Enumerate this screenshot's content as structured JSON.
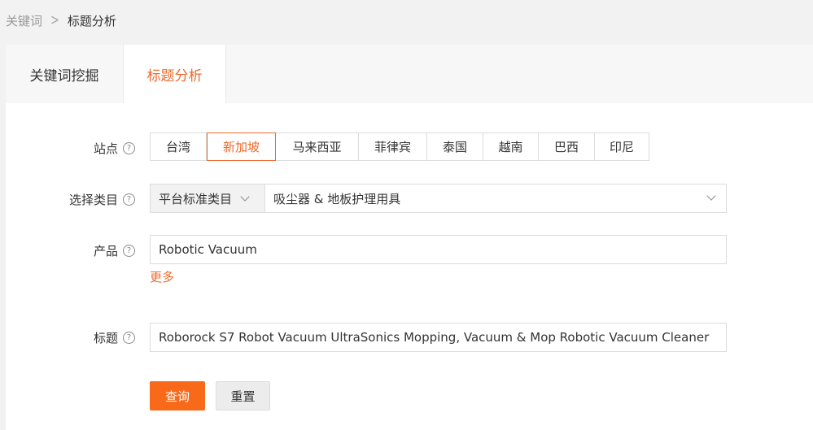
{
  "breadcrumb": {
    "prev": "关键词",
    "current": "标题分析"
  },
  "tabs": [
    {
      "label": "关键词挖掘"
    },
    {
      "label": "标题分析"
    }
  ],
  "form": {
    "site_label": "站点",
    "sites": [
      "台湾",
      "新加坡",
      "马来西亚",
      "菲律宾",
      "泰国",
      "越南",
      "巴西",
      "印尼"
    ],
    "active_site": "新加坡",
    "category_label": "选择类目",
    "category_type": "平台标准类目",
    "category_value": "吸尘器 & 地板护理用具",
    "product_label": "产品",
    "product_value": "Robotic Vacuum",
    "more": "更多",
    "title_label": "标题",
    "title_value": "Roborock S7 Robot Vacuum UltraSonics Mopping, Vacuum & Mop Robotic Vacuum Cleaner",
    "help_glyph": "?"
  },
  "buttons": {
    "query": "查询",
    "reset": "重置"
  },
  "colors": {
    "accent": "#ec6a2d",
    "primary_button": "#f86a1a"
  },
  "icons": {
    "help": "help-circle-icon",
    "chevron": "chevron-down-icon",
    "separator": "chevron-right-icon"
  }
}
